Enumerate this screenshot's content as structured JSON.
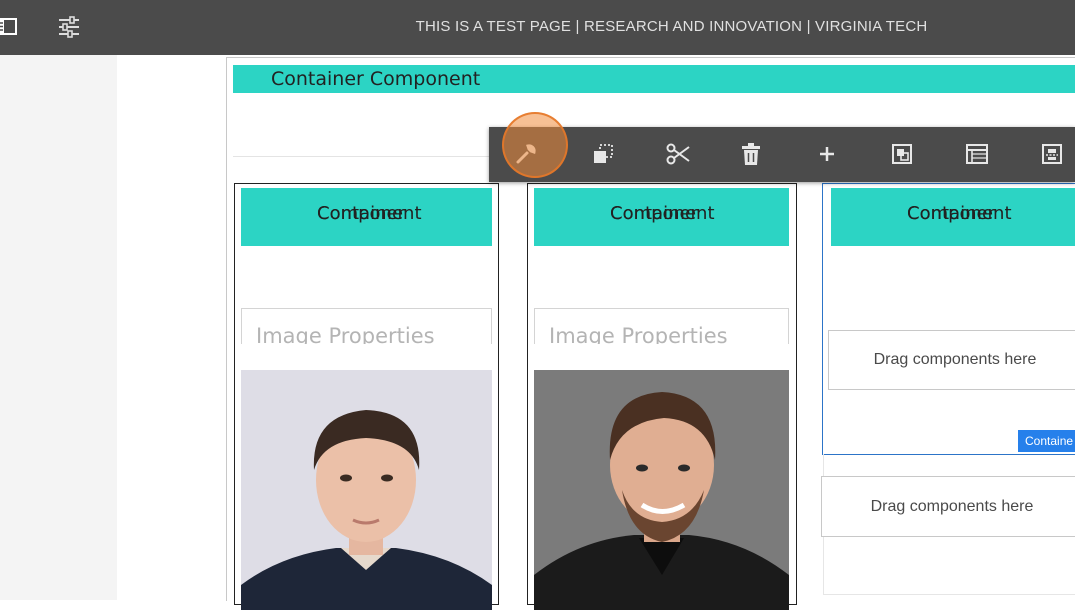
{
  "header": {
    "page_title": "THIS IS A TEST PAGE | RESEARCH AND INNOVATION | VIRGINIA TECH",
    "left_icons": [
      "side-panel-icon",
      "properties-sliders-icon"
    ]
  },
  "top_container": {
    "label": "Container Component"
  },
  "toolbar": {
    "items": [
      "wrench-icon",
      "copy-icon",
      "cut-icon",
      "delete-icon",
      "add-icon",
      "group-icon",
      "layout-icon",
      "parent-icon"
    ]
  },
  "columns": [
    {
      "label_line1": "Container",
      "label_line2": "Component",
      "image_props": "Image Properties"
    },
    {
      "label_line1": "Container",
      "label_line2": "Component",
      "image_props": "Image Properties"
    },
    {
      "label_line1": "Container",
      "label_line2": "Component"
    }
  ],
  "drag_zone_1": "Drag components here",
  "drag_zone_2": "Drag components here",
  "selected_badge": "Containe",
  "colors": {
    "teal": "#2cd4c4",
    "toolbar": "#4b4b4b",
    "accent_blue": "#2680eb",
    "highlight": "#f08c3c"
  }
}
